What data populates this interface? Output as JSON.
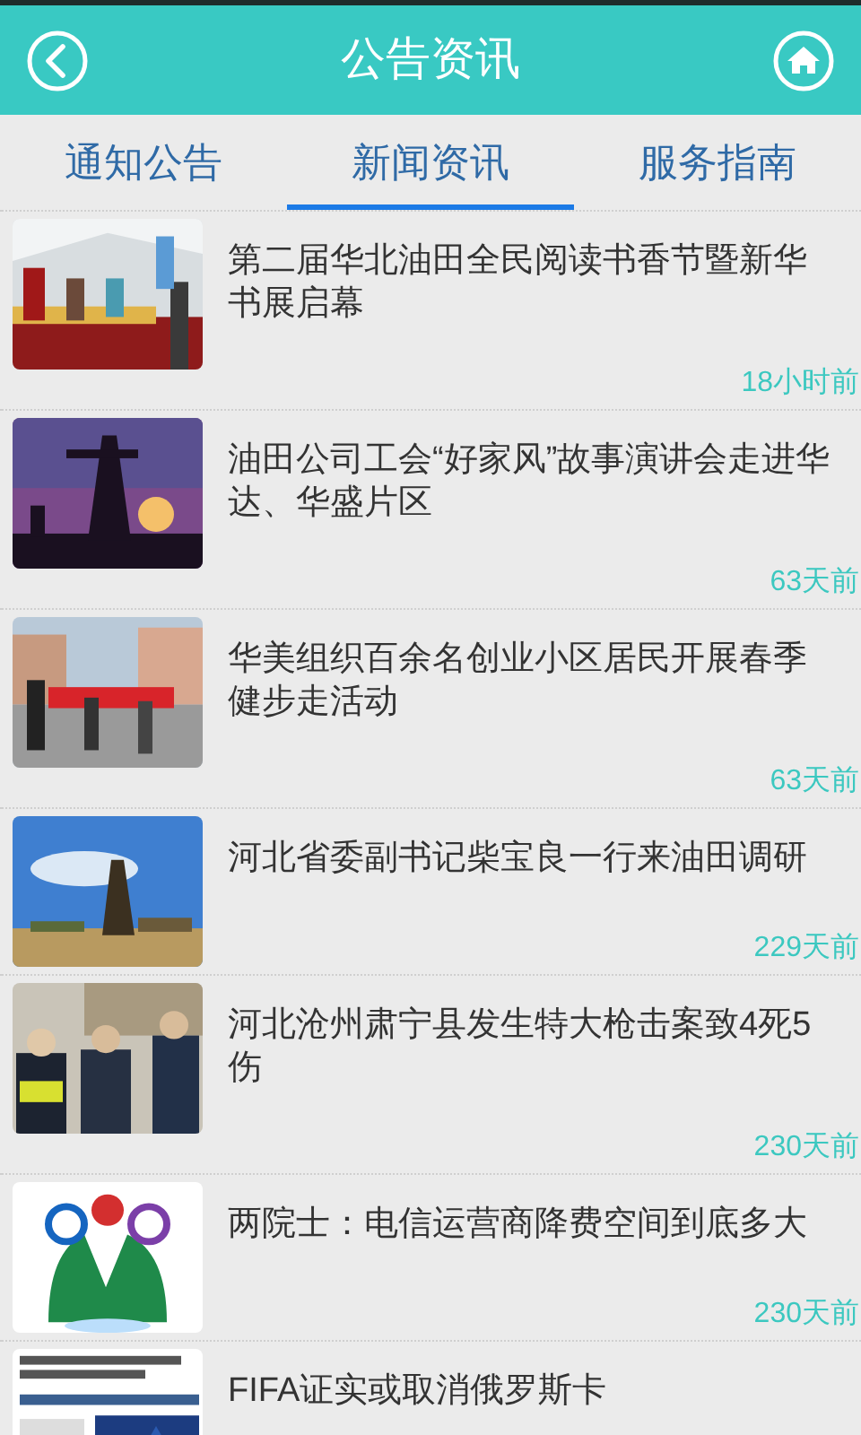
{
  "header": {
    "title": "公告资讯"
  },
  "tabs": [
    {
      "label": "通知公告",
      "selected": false
    },
    {
      "label": "新闻资讯",
      "selected": true
    },
    {
      "label": "服务指南",
      "selected": false
    }
  ],
  "news": [
    {
      "title": "第二届华北油田全民阅读书香节暨新华书展启幕",
      "time": "18小时前"
    },
    {
      "title": "油田公司工会“好家风”故事演讲会走进华达、华盛片区",
      "time": "63天前"
    },
    {
      "title": "华美组织百余名创业小区居民开展春季健步走活动",
      "time": "63天前"
    },
    {
      "title": "河北省委副书记柴宝良一行来油田调研",
      "time": "229天前"
    },
    {
      "title": "河北沧州肃宁县发生特大枪击案致4死5伤",
      "time": "230天前"
    },
    {
      "title": "两院士：电信运营商降费空间到底多大",
      "time": "230天前"
    },
    {
      "title": "FIFA证实或取消俄罗斯卡"
    }
  ]
}
